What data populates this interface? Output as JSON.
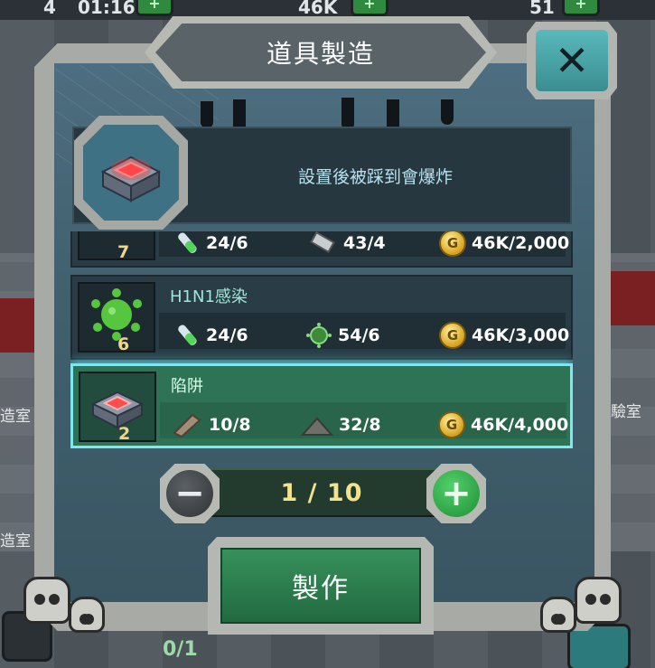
{
  "hud": {
    "top_count_left": "4",
    "top_timer": "01:16",
    "top_gold": "46K",
    "top_count_right": "51"
  },
  "background": {
    "room_label_left_1": "造室",
    "room_label_left_2": "造室",
    "room_label_right": "驗室",
    "bottom_progress": "0/1"
  },
  "dialog": {
    "title": "道具製造",
    "close_icon": "close-x-icon",
    "selected_item": {
      "icon": "trap-box-icon",
      "description": "設置後被踩到會爆炸"
    },
    "recipes": [
      {
        "name": "",
        "count": "7",
        "icon": "partial-item-icon",
        "materials": [
          {
            "icon": "test-tube-icon",
            "value": "24/6"
          },
          {
            "icon": "metal-bar-icon",
            "value": "43/4"
          },
          {
            "icon": "gold-coin-icon",
            "value": "46K/2,000"
          }
        ],
        "selected": false
      },
      {
        "name": "H1N1感染",
        "count": "6",
        "icon": "virus-icon",
        "materials": [
          {
            "icon": "test-tube-icon",
            "value": "24/6"
          },
          {
            "icon": "virus-small-icon",
            "value": "54/6"
          },
          {
            "icon": "gold-coin-icon",
            "value": "46K/3,000"
          }
        ],
        "selected": false
      },
      {
        "name": "陷阱",
        "count": "2",
        "icon": "trap-box-icon",
        "materials": [
          {
            "icon": "wood-plank-icon",
            "value": "10/8"
          },
          {
            "icon": "gunpowder-pile-icon",
            "value": "32/8"
          },
          {
            "icon": "gold-coin-icon",
            "value": "46K/4,000"
          }
        ],
        "selected": true
      }
    ],
    "quantity": {
      "display": "1 / 10",
      "current": 1,
      "max": 10,
      "minus_icon": "minus-icon",
      "plus_icon": "plus-icon"
    },
    "craft_label": "製作",
    "coin_glyph": "G"
  },
  "colors": {
    "accent_teal": "#7fe7ef",
    "selected_row": "#2f7356",
    "qty_text": "#f1e28e",
    "craft_green": "#37915a"
  }
}
